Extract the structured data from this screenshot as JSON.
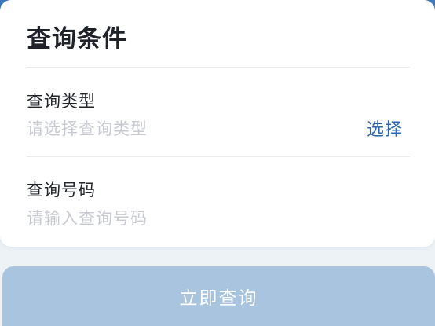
{
  "form": {
    "title": "查询条件",
    "query_type": {
      "label": "查询类型",
      "placeholder": "请选择查询类型",
      "action": "选择"
    },
    "query_number": {
      "label": "查询号码",
      "placeholder": "请输入查询号码"
    },
    "submit_label": "立即查询"
  },
  "colors": {
    "banner_blue": "#4a82c1",
    "link_blue": "#2f67ae",
    "button_disabled_blue": "#a9c4de",
    "placeholder_gray": "#c7cbd1"
  }
}
